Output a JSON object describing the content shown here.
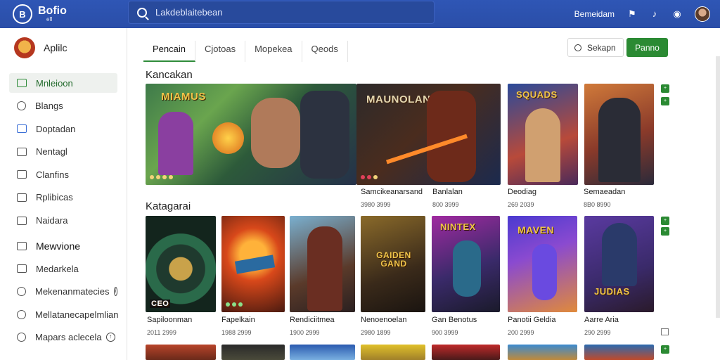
{
  "app": {
    "logo": "Bofio",
    "logo_sub": "efl",
    "logo_mark": "B"
  },
  "search": {
    "placeholder": "Lakdeblaitebean"
  },
  "top": {
    "user_label": "Bemeidam"
  },
  "profile": {
    "name": "Aplilc"
  },
  "sidebar": {
    "items": [
      {
        "label": "Mnleioon",
        "active": true
      },
      {
        "label": "Blangs"
      },
      {
        "label": "Doptadan"
      },
      {
        "label": "Nentagl"
      },
      {
        "label": "Clanfins"
      },
      {
        "label": "Rplibicas"
      },
      {
        "label": "Naidara"
      }
    ],
    "section2": [
      {
        "label": "Mewvione",
        "heading": true
      },
      {
        "label": "Medarkela"
      },
      {
        "label": "Mekenanmatecies"
      },
      {
        "label": "Mellatanecapelmlian"
      },
      {
        "label": "Mapars aclecela"
      }
    ]
  },
  "tabs": [
    {
      "label": "Pencain",
      "active": true
    },
    {
      "label": "Cjotoas"
    },
    {
      "label": "Mopekea"
    },
    {
      "label": "Qeods"
    }
  ],
  "actions": {
    "secondary": "Sekapn",
    "primary": "Panno"
  },
  "sections": {
    "featured": "Kancakan",
    "category": "Katagarai"
  },
  "featured": [
    {
      "title": "",
      "sub": "",
      "art": "MIAMUS"
    },
    {
      "title": "Samcikeanarsand",
      "sub": "3980 3999",
      "art": "MAUNOLAN"
    },
    {
      "title": "Banlalan",
      "sub": "800 3999",
      "art": ""
    },
    {
      "title": "Deodiag",
      "sub": "269 2039",
      "art": "SQUADS"
    },
    {
      "title": "Semaeadan",
      "sub": "8B0 8990",
      "art": ""
    }
  ],
  "grid": [
    {
      "title": "Sapiloonman",
      "sub": "2011 2999",
      "art": "CEO"
    },
    {
      "title": "Fapelkain",
      "sub": "1988 2999",
      "art": ""
    },
    {
      "title": "Rendiciitmea",
      "sub": "1900 2999",
      "art": ""
    },
    {
      "title": "Nenoenoelan",
      "sub": "2980 1899",
      "art": "GAIDEN GAND"
    },
    {
      "title": "Gan Benotus",
      "sub": "900 3999",
      "art": "NINTEX"
    },
    {
      "title": "Panotii Geldia",
      "sub": "200 2999",
      "art": "MAVEN"
    },
    {
      "title": "Aarre Aria",
      "sub": "290 2999",
      "art": "JUDIAS"
    }
  ],
  "colors": {
    "accent": "#2b8a33",
    "brand": "#2f56b5"
  }
}
